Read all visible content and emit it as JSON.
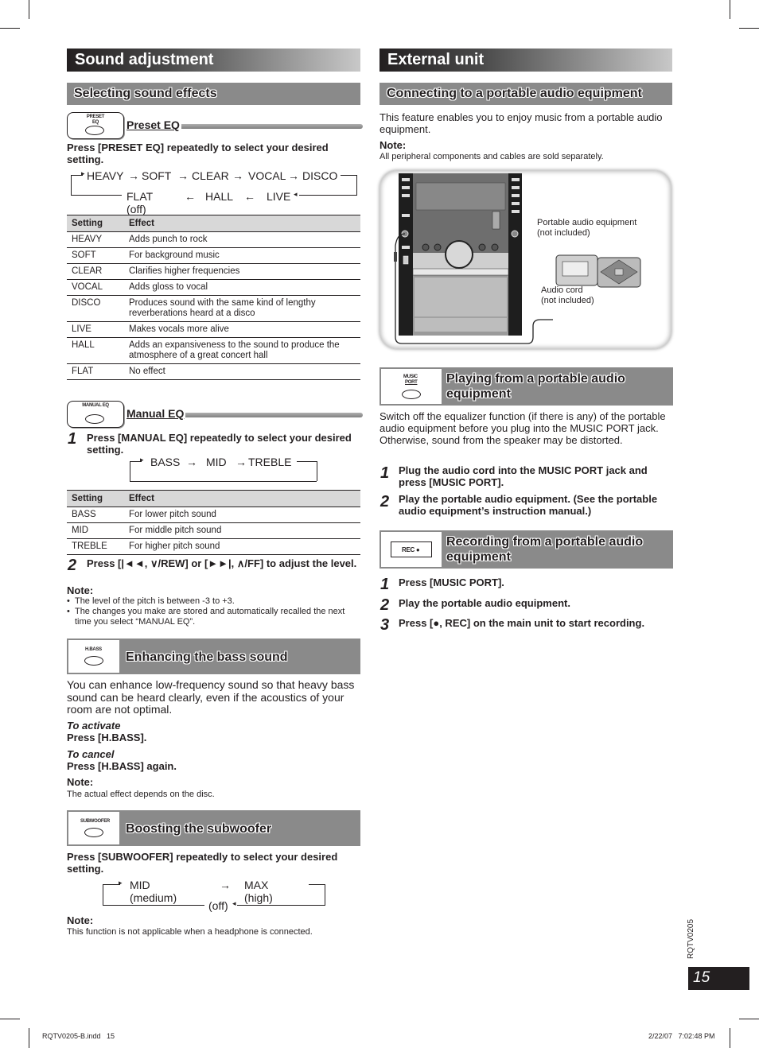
{
  "left": {
    "section_title": "Sound adjustment",
    "selecting": {
      "title": "Selecting sound effects",
      "preset": {
        "button_label": "PRESET EQ",
        "title": "Preset EQ",
        "instruction": "Press [PRESET EQ] repeatedly to select your desired setting.",
        "flow_top": [
          "HEAVY",
          "SOFT",
          "CLEAR",
          "VOCAL",
          "DISCO"
        ],
        "flow_bottom": [
          "FLAT (off)",
          "HALL",
          "LIVE"
        ],
        "table_headers": [
          "Setting",
          "Effect"
        ],
        "rows": [
          {
            "setting": "HEAVY",
            "effect": "Adds punch to rock"
          },
          {
            "setting": "SOFT",
            "effect": "For background music"
          },
          {
            "setting": "CLEAR",
            "effect": "Clarifies higher frequencies"
          },
          {
            "setting": "VOCAL",
            "effect": "Adds gloss to vocal"
          },
          {
            "setting": "DISCO",
            "effect": "Produces sound with the same kind of lengthy reverberations heard at a disco"
          },
          {
            "setting": "LIVE",
            "effect": "Makes vocals more alive"
          },
          {
            "setting": "HALL",
            "effect": "Adds an expansiveness to the sound to produce the atmosphere of a great concert hall"
          },
          {
            "setting": "FLAT",
            "effect": "No effect"
          }
        ]
      },
      "manual": {
        "button_label": "MANUAL EQ",
        "title": "Manual EQ",
        "step1_num": "1",
        "step1": "Press [MANUAL EQ] repeatedly to select your desired setting.",
        "flow": [
          "BASS",
          "MID",
          "TREBLE"
        ],
        "table_headers": [
          "Setting",
          "Effect"
        ],
        "rows": [
          {
            "setting": "BASS",
            "effect": "For lower pitch sound"
          },
          {
            "setting": "MID",
            "effect": "For middle pitch sound"
          },
          {
            "setting": "TREBLE",
            "effect": "For higher pitch sound"
          }
        ],
        "step2_num": "2",
        "step2": "Press [|◄◄, ∨/REW] or [►►|, ∧/FF] to adjust the level.",
        "note_label": "Note:",
        "notes": [
          "The level of the pitch is between -3 to +3.",
          "The changes you make are stored and automatically recalled the next time you select “MANUAL EQ”."
        ]
      }
    },
    "bass": {
      "button_label": "H.BASS",
      "title": "Enhancing the bass sound",
      "body": "You can enhance low-frequency sound so that heavy bass sound can be heard clearly, even if the acoustics of your room are not optimal.",
      "activate_label": "To activate",
      "activate_text": "Press [H.BASS].",
      "cancel_label": "To cancel",
      "cancel_text": "Press [H.BASS] again.",
      "note_label": "Note:",
      "note": "The actual effect depends on the disc."
    },
    "subwoofer": {
      "button_label": "SUBWOOFER",
      "title": "Boosting the subwoofer",
      "instruction": "Press [SUBWOOFER] repeatedly to select your desired setting.",
      "flow_top": [
        "MID (medium)",
        "MAX (high)"
      ],
      "flow_bottom": "(off)",
      "note_label": "Note:",
      "note": "This function is not applicable when a headphone is connected."
    }
  },
  "right": {
    "section_title": "External unit",
    "connecting": {
      "title": "Connecting to a portable audio equipment",
      "body": "This feature enables you to enjoy music from a portable audio equipment.",
      "note_label": "Note:",
      "note": "All peripheral components and cables are sold separately.",
      "diagram_label_1": "Portable audio equipment",
      "diagram_label_1b": "(not included)",
      "diagram_label_2": "Audio cord",
      "diagram_label_2b": "(not included)"
    },
    "playing": {
      "button_label_1": "MUSIC",
      "button_label_2": "PORT",
      "title": "Playing from a portable audio equipment",
      "body": "Switch off the equalizer function (if there is any) of the portable audio equipment before you plug into the MUSIC PORT jack. Otherwise, sound from the speaker may be distorted.",
      "steps": [
        {
          "num": "1",
          "text": "Plug the audio cord into the MUSIC PORT jack and press [MUSIC PORT]."
        },
        {
          "num": "2",
          "text": "Play the portable audio equipment. (See the portable audio equipment’s instruction manual.)"
        }
      ]
    },
    "recording": {
      "button_label": "REC ●",
      "title": "Recording from a portable audio equipment",
      "steps": [
        {
          "num": "1",
          "text": "Press [MUSIC PORT]."
        },
        {
          "num": "2",
          "text": "Play the portable audio equipment."
        },
        {
          "num": "3",
          "text": "Press [●, REC] on the main unit to start recording."
        }
      ]
    }
  },
  "page": {
    "doc_code": "RQTV0205",
    "page_number": "15",
    "footer_left": "RQTV0205-B.indd   15",
    "footer_right": "2/22/07   7:02:48 PM"
  }
}
